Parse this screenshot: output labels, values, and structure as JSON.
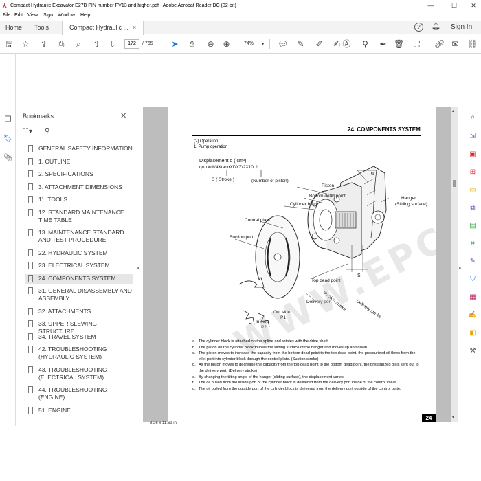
{
  "window": {
    "title": "Compact Hydraulic Excavator E27B PIN number PV13 and higher.pdf - Adobe Acrobat Reader DC (32-bit)",
    "minimize": "—",
    "maximize": "☐",
    "close": "✕"
  },
  "menu": [
    "File",
    "Edit",
    "View",
    "Sign",
    "Window",
    "Help"
  ],
  "tabs": {
    "home": "Home",
    "tools": "Tools",
    "document": "Compact Hydraulic ...",
    "close": "×",
    "help": "?",
    "sign_in": "Sign In"
  },
  "toolbar": {
    "current_page": "172",
    "page_total": "/  765",
    "zoom": "74%",
    "icons": [
      "save-icon",
      "bookmark-star-icon",
      "upload-icon",
      "print-icon",
      "zoom-search-icon",
      "page-up-icon",
      "page-down-icon",
      "select-cursor-icon",
      "hand-icon",
      "zoom-out-icon",
      "zoom-in-icon",
      "zoom-dropdown-icon",
      "comment-icon",
      "pen-icon",
      "highlight-icon",
      "signature-icon",
      "delete-icon",
      "stamp-icon",
      "mail-icon",
      "link-icon"
    ]
  },
  "bookmarks": {
    "title": "Bookmarks",
    "close": "✕",
    "items": [
      {
        "label": "GENERAL SAFETY INFORMATION",
        "active": false
      },
      {
        "label": "1. OUTLINE",
        "active": false
      },
      {
        "label": "2. SPECIFICATIONS",
        "active": false
      },
      {
        "label": "3. ATTACHMENT DIMENSIONS",
        "active": false
      },
      {
        "label": "11. TOOLS",
        "active": false
      },
      {
        "label": "12. STANDARD MAINTENANCE TIME TABLE",
        "active": false
      },
      {
        "label": "13. MAINTENANCE STANDARD AND TEST PROCEDURE",
        "active": false
      },
      {
        "label": "22. HYDRAULIC SYSTEM",
        "active": false
      },
      {
        "label": "23. ELECTRICAL SYSTEM",
        "active": false
      },
      {
        "label": "24. COMPONENTS SYSTEM",
        "active": true
      },
      {
        "label": "31. GENERAL DISASSEMBLY AND ASSEMBLY",
        "active": false
      },
      {
        "label": "32. ATTACHMENTS",
        "active": false
      },
      {
        "label": "33. UPPER SLEWING STRUCTURE",
        "active": false
      },
      {
        "label": "34. TRAVEL SYSTEM",
        "active": false
      },
      {
        "label": "42. TROUBLESHOOTING (HYDRAULIC SYSTEM)",
        "active": false
      },
      {
        "label": "43. TROUBLESHOOTING (ELECTRICAL SYSTEM)",
        "active": false
      },
      {
        "label": "44. TROUBLESHOOTING (ENGINE)",
        "active": false
      },
      {
        "label": "51. ENGINE",
        "active": false
      }
    ]
  },
  "document": {
    "header": "24.  COMPONENTS SYSTEM",
    "section": "(2)  Operation",
    "subsection": "1. Pump operation",
    "formula_title": "Displacement q ( cm³)",
    "formula": "q=πXd²/4XtanαXDXZ/2X10⁻³",
    "formula_s": "S (   Stroke    )",
    "formula_z": "(Number of piston)",
    "labels": {
      "piston": "Piston",
      "bottom_dead_point": "Bottom dead point",
      "cylinder_block": "Cylinder block",
      "hanger": "Hanger",
      "sliding_surface": "(Sliding surface)",
      "control_plate": "Control plate",
      "suction_port": "Suction port",
      "top_dead_point": "Top dead point",
      "s": "S",
      "alpha": "α",
      "suction_stroke": "Suction stroke",
      "delivery_port": "Delivery port",
      "delivery_stroke": "Delivery stroke",
      "out_side": "Out side",
      "p1": "P1",
      "in_side": "In side",
      "p2": "P2"
    },
    "notes": [
      {
        "key": "a.",
        "text": "The cylinder block is attached on the spline and rotates with the drive shaft."
      },
      {
        "key": "b.",
        "text": "The piston  on the cylinder block follows the sliding surface of the hanger and moves  up and down."
      },
      {
        "key": "c.",
        "text": "The piston moves to increase the capacity from the bottom dead point to the top dead point, the pressurized oil flows from the inlet port into cylinder block through the control plate. (Suction stroke)"
      },
      {
        "key": "d.",
        "text": "As the piston moves to decrease the capacity from the top dead point to the bottom dead point, the pressurized oil is sent out to the delivery port. (Delivery stroke)"
      },
      {
        "key": "e.",
        "text": "By changing the tilting angle of the hanger (sliding surface), the displacement varies."
      },
      {
        "key": "f.",
        "text": "The oil pulled from the inside port of the cylinder block is delivered from the delivery port inside of the control valve."
      },
      {
        "key": "g.",
        "text": "The oil pulled from the outside port of the cylinder block is delivered from the delivery port outside of the control plate."
      }
    ],
    "page_tab": "24",
    "watermark": "WWW.EPCDEMO.COM"
  },
  "status": {
    "page_size": "8.26 x 11.69 in"
  }
}
